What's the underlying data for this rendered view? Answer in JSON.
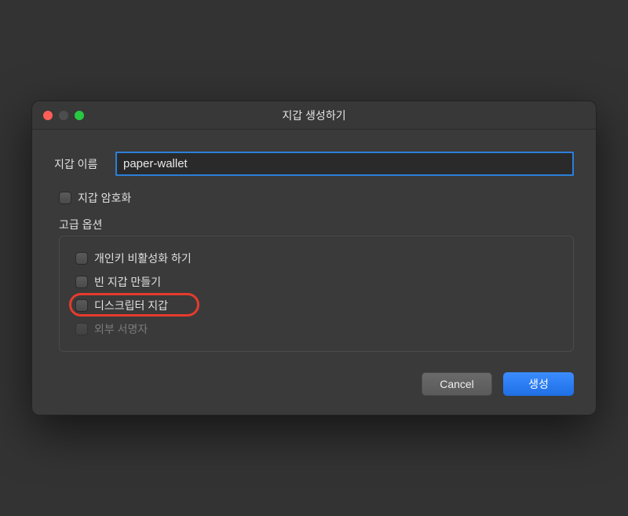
{
  "window": {
    "title": "지갑 생성하기"
  },
  "form": {
    "wallet_name_label": "지갑 이름",
    "wallet_name_value": "paper-wallet",
    "encrypt_wallet_label": "지갑 암호화",
    "advanced_options_label": "고급 옵션",
    "options": {
      "disable_private_keys": "개인키 비활성화 하기",
      "make_blank_wallet": "빈 지갑 만들기",
      "descriptor_wallet": "디스크립터 지갑",
      "external_signer": "외부 서명자"
    }
  },
  "buttons": {
    "cancel": "Cancel",
    "create": "생성"
  }
}
